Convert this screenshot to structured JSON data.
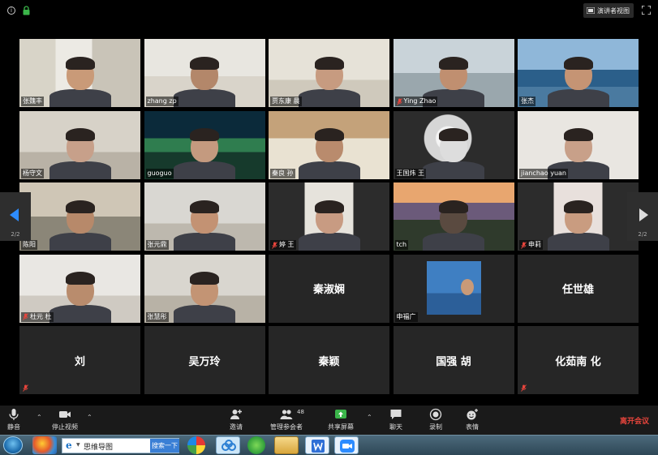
{
  "topbar": {
    "speaker_view_label": "演讲者视图"
  },
  "tiles": [
    {
      "name": "张魏丰",
      "muted": false,
      "type": "video",
      "active": true
    },
    {
      "name": "zhang zp",
      "muted": false,
      "type": "video"
    },
    {
      "name": "贾东康 晨",
      "muted": false,
      "type": "video"
    },
    {
      "name": "Ying Zhao",
      "muted": true,
      "type": "video"
    },
    {
      "name": "张杰",
      "muted": false,
      "type": "video"
    },
    {
      "name": "杨守文",
      "muted": false,
      "type": "video"
    },
    {
      "name": "guoguo",
      "muted": false,
      "type": "video"
    },
    {
      "name": "秦良 孙",
      "muted": false,
      "type": "video"
    },
    {
      "name": "王国炜 王",
      "muted": false,
      "type": "video"
    },
    {
      "name": "jianchao yuan",
      "muted": false,
      "type": "video"
    },
    {
      "name": "陈阳",
      "muted": false,
      "type": "video"
    },
    {
      "name": "张元鼎",
      "muted": false,
      "type": "video"
    },
    {
      "name": "婷 王",
      "muted": true,
      "type": "video"
    },
    {
      "name": "tch",
      "muted": false,
      "type": "video"
    },
    {
      "name": "申莉",
      "muted": true,
      "type": "video"
    },
    {
      "name": "杜元 杜",
      "muted": true,
      "type": "video"
    },
    {
      "name": "张慧彤",
      "muted": false,
      "type": "video"
    },
    {
      "name": "秦淑娴",
      "muted": false,
      "type": "name-only"
    },
    {
      "name": "申福广",
      "muted": false,
      "type": "photo"
    },
    {
      "name": "任世雄",
      "muted": false,
      "type": "name-only"
    },
    {
      "name": "刘",
      "muted": true,
      "type": "name-only"
    },
    {
      "name": "吴万玲",
      "muted": false,
      "type": "name-only"
    },
    {
      "name": "秦颖",
      "muted": false,
      "type": "name-only"
    },
    {
      "name": "国强 胡",
      "muted": false,
      "type": "name-only"
    },
    {
      "name": "化茹南 化",
      "muted": true,
      "type": "name-only"
    }
  ],
  "page_nav": {
    "left_label": "2/2",
    "right_label": "2/2"
  },
  "toolbar": {
    "mute_label": "静音",
    "stop_video_label": "停止视频",
    "invite_label": "邀请",
    "participants_label": "管理参会者",
    "participants_count": "48",
    "share_label": "共享屏幕",
    "chat_label": "聊天",
    "record_label": "录制",
    "reactions_label": "表情",
    "leave_label": "离开会议"
  },
  "taskbar": {
    "search_text": "思维导图",
    "search_button": "搜索一下"
  },
  "colors": {
    "active_speaker": "#f0e83a",
    "zoom_blue": "#2d8cff",
    "leave_red": "#e8453c",
    "share_green": "#3bb54a"
  }
}
